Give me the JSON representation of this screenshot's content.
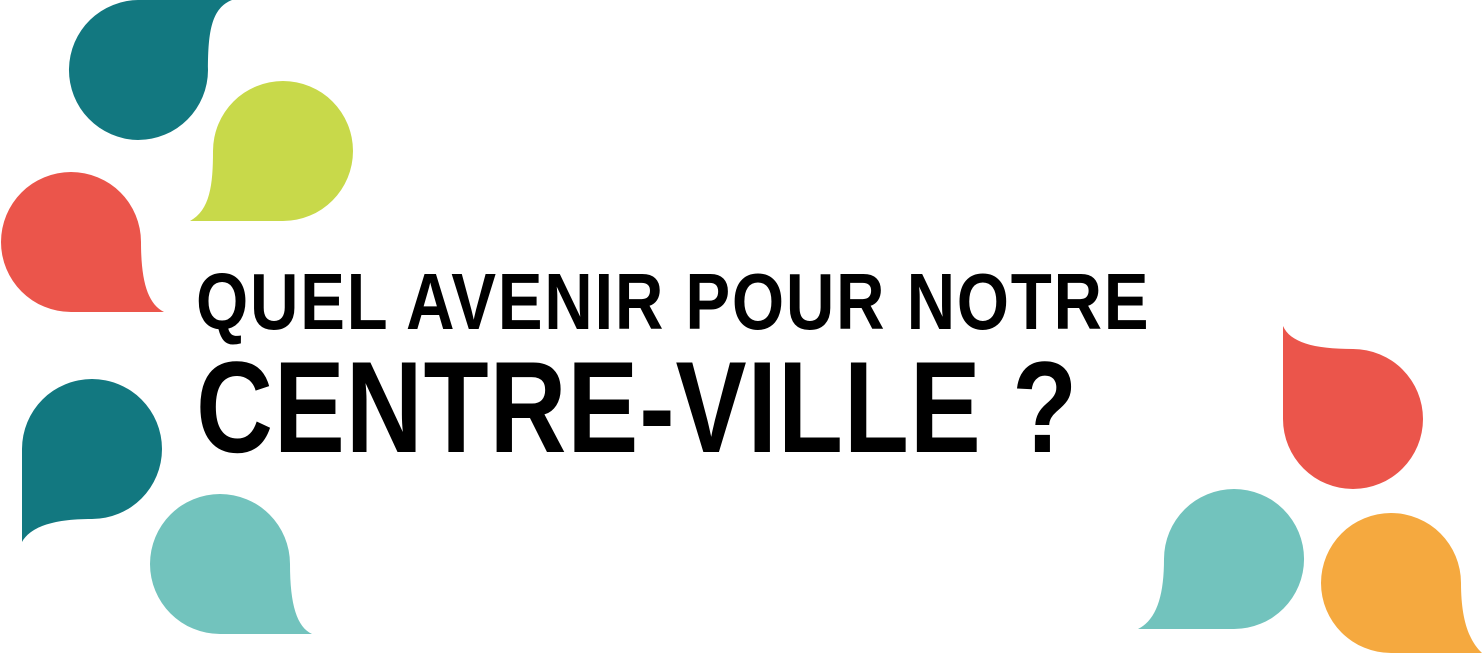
{
  "headline": {
    "line1": "QUEL AVENIR POUR NOTRE",
    "line2": "CENTRE-VILLE ?"
  },
  "colors": {
    "teal_dark": "#127880",
    "lime": "#c8d94a",
    "coral": "#eb554b",
    "teal_light": "#72c3bd",
    "orange": "#f5a93f",
    "text": "#000000",
    "background": "#ffffff"
  },
  "decorations": [
    {
      "name": "speech-bubble-icon",
      "color": "teal_dark"
    },
    {
      "name": "speech-bubble-icon",
      "color": "lime"
    },
    {
      "name": "speech-bubble-icon",
      "color": "coral"
    },
    {
      "name": "speech-bubble-icon",
      "color": "teal_dark"
    },
    {
      "name": "speech-bubble-icon",
      "color": "teal_light"
    },
    {
      "name": "speech-bubble-icon",
      "color": "coral"
    },
    {
      "name": "speech-bubble-icon",
      "color": "teal_light"
    },
    {
      "name": "speech-bubble-icon",
      "color": "orange"
    }
  ]
}
